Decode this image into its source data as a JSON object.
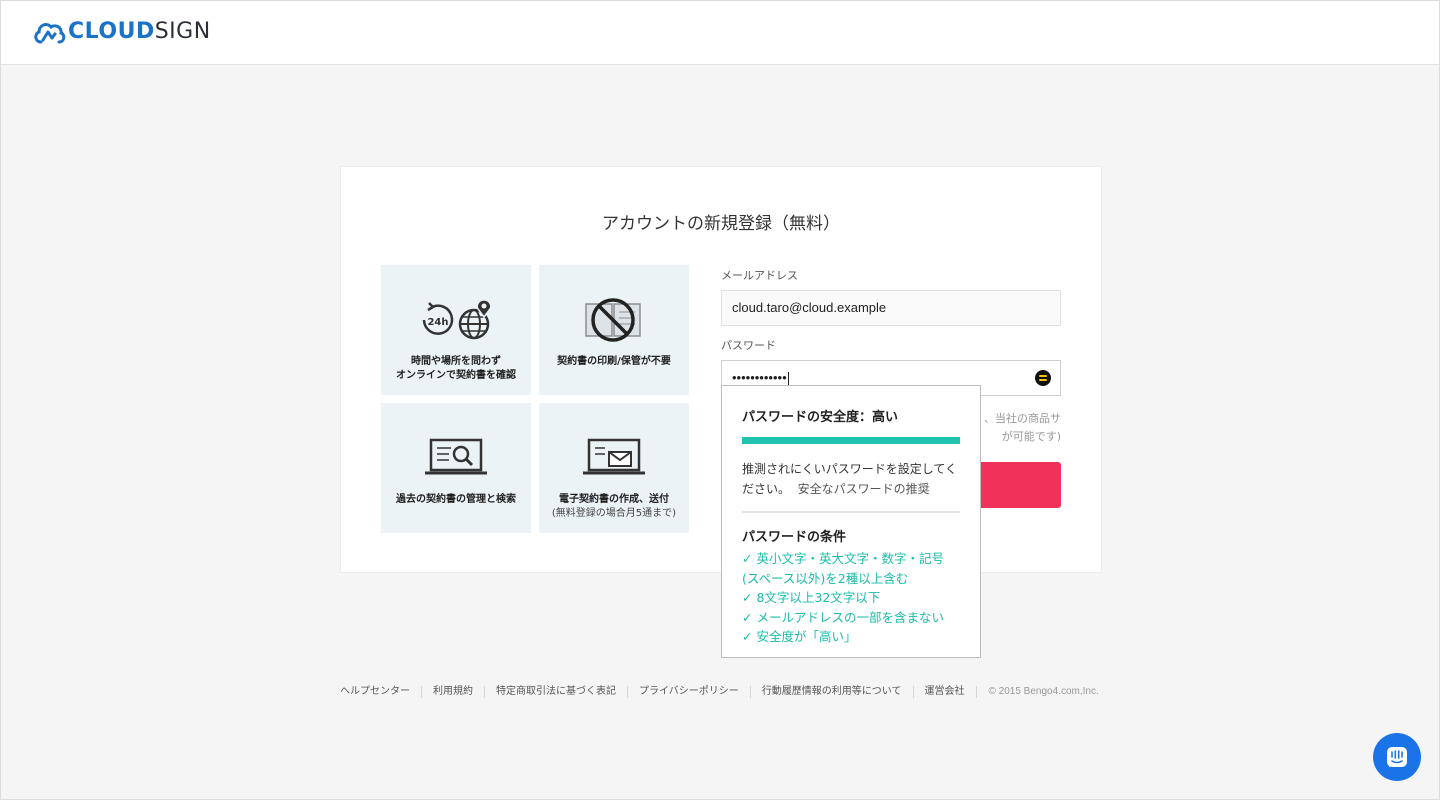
{
  "header": {
    "logo_bold": "CLOUD",
    "logo_light": "SIGN"
  },
  "card": {
    "title": "アカウントの新規登録（無料）",
    "tiles": [
      {
        "line1": "時間や場所を問わず",
        "line2": "オンラインで契約書を確認",
        "icon": "clock-globe-icon"
      },
      {
        "line1": "契約書の印刷/保管が不要",
        "icon": "no-paper-icon"
      },
      {
        "line1": "過去の契約書の管理と検索",
        "icon": "laptop-search-icon"
      },
      {
        "line1": "電子契約書の作成、送付",
        "line2": "(無料登録の場合月5通まで)",
        "icon": "laptop-mail-icon"
      }
    ]
  },
  "form": {
    "email_label": "メールアドレス",
    "email_value": "cloud.taro@cloud.example",
    "password_label": "パスワード",
    "password_value": "••••••••••••",
    "hidden_text_1": "、当社の商品サ",
    "hidden_text_2": "が可能です)"
  },
  "popup": {
    "strength_title": "パスワードの安全度：高い",
    "strength_level": 1.0,
    "description": "推測されにくいパスワードを設定してください。",
    "recommend_link": "安全なパスワードの推奨",
    "conditions_title": "パスワードの条件",
    "conditions": [
      "✓ 英小文字・英大文字・数字・記号(スペース以外)を2種以上含む",
      "✓ 8文字以上32文字以下",
      "✓ メールアドレスの一部を含まない",
      "✓ 安全度が「高い」"
    ]
  },
  "footer": {
    "links": [
      "ヘルプセンター",
      "利用規約",
      "特定商取引法に基づく表記",
      "プライバシーポリシー",
      "行動履歴情報の利用等について",
      "運営会社"
    ],
    "copyright": "© 2015 Bengo4.com,Inc."
  },
  "colors": {
    "brand_blue": "#1a73c9",
    "accent_red": "#f0325a",
    "strength_teal": "#1fc3b0"
  }
}
